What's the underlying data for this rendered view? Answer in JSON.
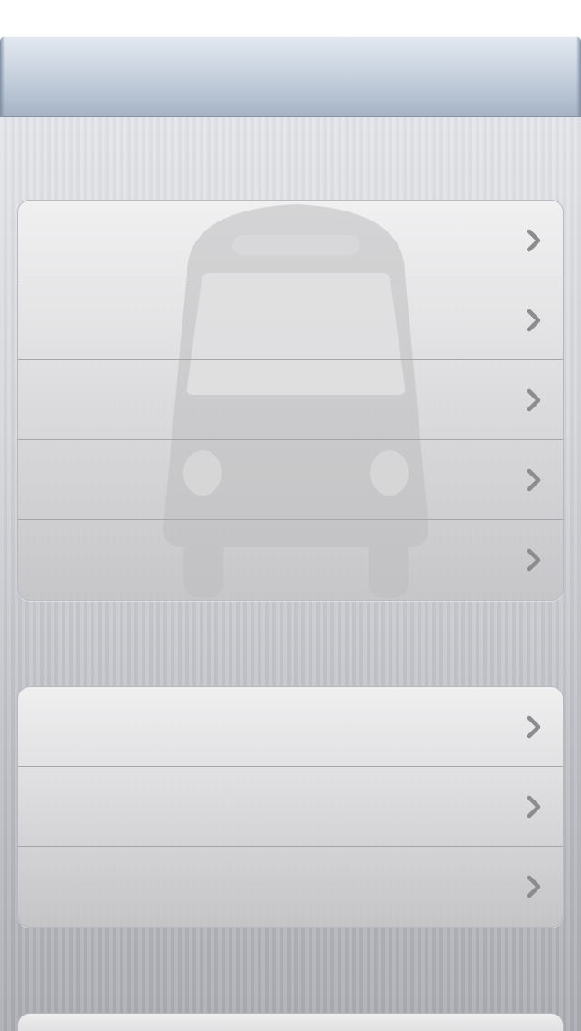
{
  "status_bar": {
    "text": ""
  },
  "nav_bar": {
    "title": ""
  },
  "group_1": {
    "rows": [
      {
        "label": "",
        "icon": "chevron-right-icon"
      },
      {
        "label": "",
        "icon": "chevron-right-icon"
      },
      {
        "label": "",
        "icon": "chevron-right-icon"
      },
      {
        "label": "",
        "icon": "chevron-right-icon"
      },
      {
        "label": "",
        "icon": "chevron-right-icon"
      }
    ],
    "background_icon": "bus-icon"
  },
  "group_2": {
    "rows": [
      {
        "label": "",
        "icon": "chevron-right-icon"
      },
      {
        "label": "",
        "icon": "chevron-right-icon"
      },
      {
        "label": "",
        "icon": "chevron-right-icon"
      }
    ]
  },
  "colors": {
    "nav_bar": "#c3cedb",
    "chevron": "#8c8c8e",
    "watermark": "#bdbdbf"
  }
}
